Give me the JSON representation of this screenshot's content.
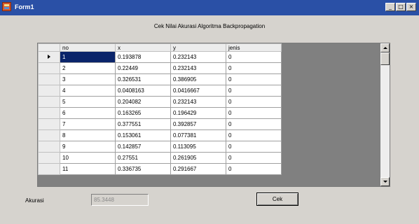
{
  "window": {
    "title": "Form1",
    "minimize_glyph": "_",
    "maximize_glyph": "□",
    "close_glyph": "×"
  },
  "heading": "Cek Nilai Akurasi Algoritma Backpropagation",
  "grid": {
    "columns": [
      "no",
      "x",
      "y",
      "jenis"
    ],
    "selected_row": 0,
    "rows": [
      [
        "1",
        "0.193878",
        "0.232143",
        "0"
      ],
      [
        "2",
        "0.22449",
        "0.232143",
        "0"
      ],
      [
        "3",
        "0.326531",
        "0.386905",
        "0"
      ],
      [
        "4",
        "0.0408163",
        "0.0416667",
        "0"
      ],
      [
        "5",
        "0.204082",
        "0.232143",
        "0"
      ],
      [
        "6",
        "0.163265",
        "0.196429",
        "0"
      ],
      [
        "7",
        "0.377551",
        "0.392857",
        "0"
      ],
      [
        "8",
        "0.153061",
        "0.077381",
        "0"
      ],
      [
        "9",
        "0.142857",
        "0.113095",
        "0"
      ],
      [
        "10",
        "0.27551",
        "0.261905",
        "0"
      ],
      [
        "11",
        "0.336735",
        "0.291667",
        "0"
      ]
    ]
  },
  "accuracy": {
    "label": "Akurasi",
    "value": "85.3448"
  },
  "cek_button": "Cek",
  "colors": {
    "titlebar": "#2a50a6",
    "selection": "#0a246a",
    "form_background": "#d6d3ce",
    "grid_background": "#808080"
  }
}
